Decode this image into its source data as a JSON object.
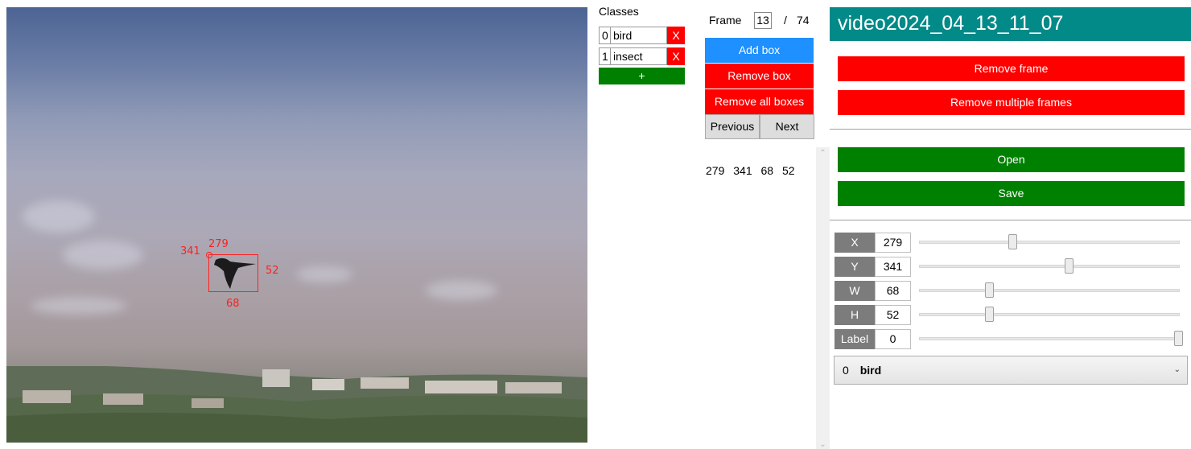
{
  "classes": {
    "title": "Classes",
    "items": [
      {
        "id": "0",
        "name": "bird",
        "remove_label": "X"
      },
      {
        "id": "1",
        "name": "insect",
        "remove_label": "X"
      }
    ],
    "add_label": "+"
  },
  "frame": {
    "label": "Frame",
    "current": "13",
    "separator": "/",
    "total": "74"
  },
  "box_controls": {
    "add_box": "Add box",
    "remove_box": "Remove box",
    "remove_all_boxes": "Remove all boxes",
    "previous": "Previous",
    "next": "Next"
  },
  "box_list": [
    {
      "x": "279",
      "y": "341",
      "w": "68",
      "h": "52"
    }
  ],
  "image_annotation": {
    "x": "279",
    "y": "341",
    "w": "68",
    "h": "52"
  },
  "title": "video2024_04_13_11_07",
  "actions": {
    "remove_frame": "Remove frame",
    "remove_multiple_frames": "Remove multiple frames",
    "open": "Open",
    "save": "Save"
  },
  "properties": [
    {
      "label": "X",
      "value": "279",
      "slider_fraction": 0.35
    },
    {
      "label": "Y",
      "value": "341",
      "slider_fraction": 0.57
    },
    {
      "label": "W",
      "value": "68",
      "slider_fraction": 0.26
    },
    {
      "label": "H",
      "value": "52",
      "slider_fraction": 0.26
    },
    {
      "label": "Label",
      "value": "0",
      "slider_fraction": 1.0
    }
  ],
  "class_select": {
    "id": "0",
    "name": "bird"
  },
  "colors": {
    "title_bar": "#028a88",
    "danger": "#ff0000",
    "success": "#008000",
    "primary": "#1e90ff",
    "annotation": "#ff2020"
  }
}
